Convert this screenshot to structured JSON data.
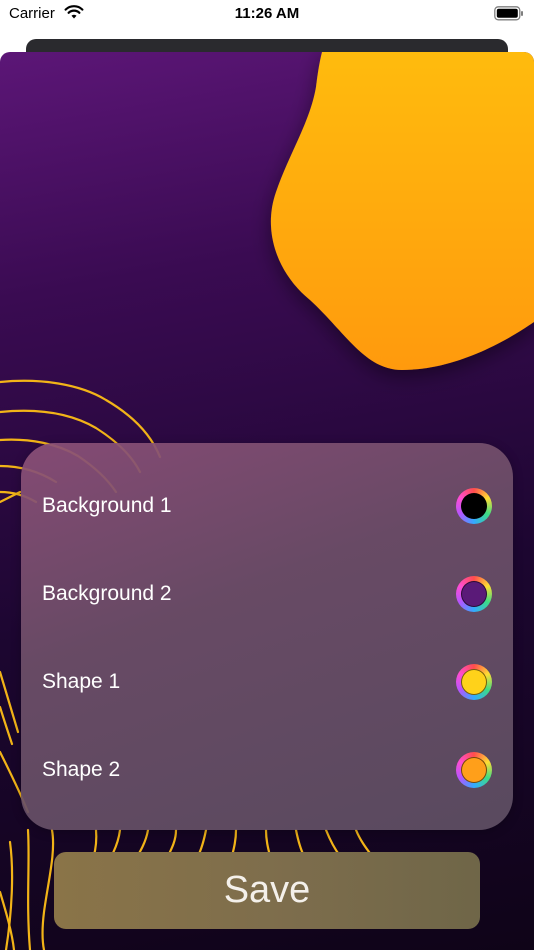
{
  "status_bar": {
    "carrier": "Carrier",
    "time": "11:26 AM"
  },
  "settings": {
    "rows": [
      {
        "label": "Background 1",
        "color": "#000000"
      },
      {
        "label": "Background 2",
        "color": "#5a1a78"
      },
      {
        "label": "Shape 1",
        "color": "#ffd21a"
      },
      {
        "label": "Shape 2",
        "color": "#ff9f1a"
      }
    ]
  },
  "save_label": "Save",
  "colors": {
    "background_top": "#5c1677",
    "background_bottom": "#0f0418",
    "blob_top": "#ffb80f",
    "blob_bottom": "#ff9a0a",
    "contour_lines": "#f2b418"
  }
}
